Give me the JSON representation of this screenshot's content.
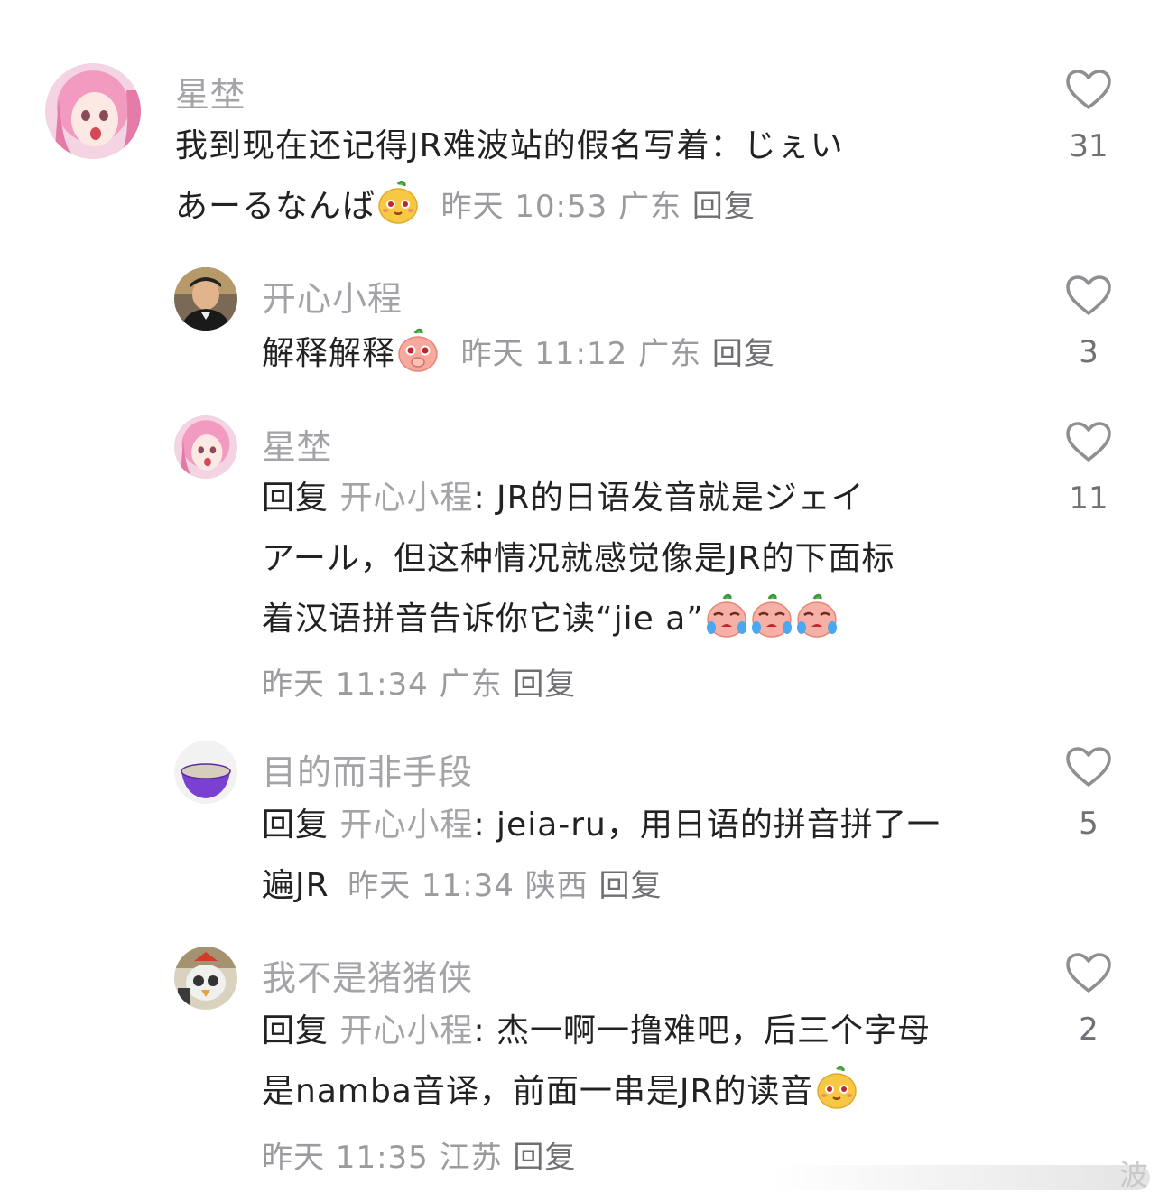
{
  "comments": [
    {
      "username": "星埜",
      "text": "我到现在还记得JR难波站的假名写着：じぇい",
      "text2": "あーるなんば",
      "time": "昨天 10:53",
      "location": "广东",
      "reply_label": "回复",
      "likes": "31",
      "emoji": "yellow-smile-emoji"
    },
    {
      "username": "开心小程",
      "text": "解释解释",
      "time": "昨天 11:12",
      "location": "广东",
      "reply_label": "回复",
      "likes": "3",
      "emoji": "pink-pleading-emoji"
    },
    {
      "username": "星埜",
      "reply_prefix": "回复",
      "reply_target": "开心小程",
      "line1": ": JR的日语发音就是ジェイ",
      "line2": "アール，但这种情况就感觉像是JR的下面标",
      "line3": "着汉语拼音告诉你它读“jie a”",
      "time": "昨天 11:34",
      "location": "广东",
      "reply_label": "回复",
      "likes": "11",
      "emoji": "pink-crying-emoji"
    },
    {
      "username": "目的而非手段",
      "reply_prefix": "回复",
      "reply_target": "开心小程",
      "line1": ": jeia-ru，用日语的拼音拼了一",
      "line2": "遍JR",
      "time": "昨天 11:34",
      "location": "陕西",
      "reply_label": "回复",
      "likes": "5"
    },
    {
      "username": "我不是猪猪侠",
      "reply_prefix": "回复",
      "reply_target": "开心小程",
      "line1": ": 杰一啊一撸难吧，后三个字母",
      "line2": "是namba音译，前面一串是JR的读音",
      "time": "昨天 11:35",
      "location": "江苏",
      "reply_label": "回复",
      "likes": "2",
      "emoji": "yellow-smile-emoji"
    }
  ],
  "watermark_char": "波",
  "colors": {
    "username": "#a3a3a8",
    "text": "#222222",
    "meta": "#9a9a9f",
    "like_icon": "#8e8e93"
  }
}
